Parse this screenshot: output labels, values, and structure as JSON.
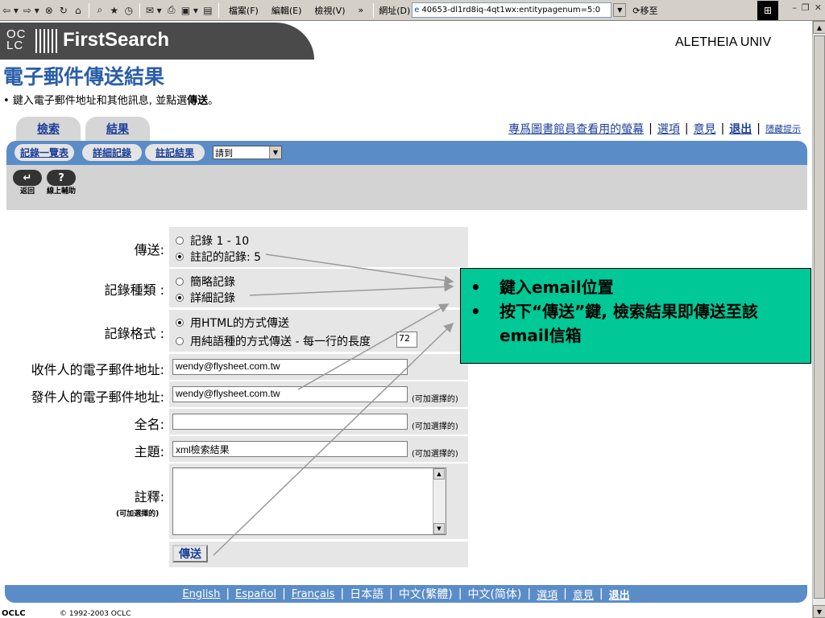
{
  "browser": {
    "menus": [
      "檔案(F)",
      "編輯(E)",
      "檢視(V)"
    ],
    "address_label": "網址(D)",
    "address_value": "40653-dl1rd8iq-4qt1wx:entitypagenum=5:0",
    "go_label": "移至",
    "toolbar_more": "»"
  },
  "header": {
    "logo_text_top": "OC",
    "logo_text_bottom": "LC",
    "brand": "FirstSearch",
    "institution": "ALETHEIA UNIV"
  },
  "page": {
    "title": "電子郵件傳送結果",
    "instruction_prefix": "• 鍵入電子郵件地址和其他訊息, 並點選",
    "instruction_bold": "傳送",
    "instruction_suffix": "。"
  },
  "tabs": [
    {
      "label": "檢索"
    },
    {
      "label": "結果"
    }
  ],
  "top_links": {
    "librarian": "專爲圖書館員查看用的螢幕",
    "options": "選項",
    "feedback": "意見",
    "exit": "退出",
    "hide_tips": "隱藏提示"
  },
  "subnav": {
    "list": "記錄一覽表",
    "detailed": "詳細記錄",
    "marked": "註記結果",
    "goto_value": "請到"
  },
  "actions": {
    "back": "返回",
    "help": "線上輔助"
  },
  "form": {
    "send_label": "傳送:",
    "send_options": [
      "記錄 1 - 10",
      "註記的記錄: 5"
    ],
    "type_label": "記錄種類 :",
    "type_options": [
      "簡略記錄",
      "詳細記錄"
    ],
    "format_label": "記錄格式 :",
    "format_options": [
      "用HTML的方式傳送",
      "用純語種的方式傳送 - 每一行的長度"
    ],
    "line_length": "72",
    "to_label": "收件人的電子郵件地址:",
    "to_value": "wendy@flysheet.com.tw",
    "from_label": "發件人的電子郵件地址:",
    "from_value": "wendy@flysheet.com.tw",
    "name_label": "全名:",
    "name_value": "",
    "subject_label": "主題:",
    "subject_value": "xml檢索結果",
    "comments_label": "註釋:",
    "optional": "(可加選擇的)",
    "submit": "傳送"
  },
  "callout": {
    "bullet": "•",
    "line1": "鍵入email位置",
    "line2": "按下“傳送”鍵, 檢索結果即傳送至該email信箱"
  },
  "footer": {
    "english": "English",
    "espanol": "Español",
    "francais": "Français",
    "japanese": "日本語",
    "trad_chinese": "中文(繁體)",
    "simp_chinese": "中文(简体)",
    "options": "選項",
    "feedback": "意見",
    "exit": "退出",
    "copyright": "© 1992-2003 OCLC",
    "logo_text": "OCLC"
  },
  "colors": {
    "title_blue": "#2a5ea9",
    "nav_blue": "#5a8dc7",
    "callout_green": "#00c896",
    "link_blue": "#1c3f99"
  }
}
